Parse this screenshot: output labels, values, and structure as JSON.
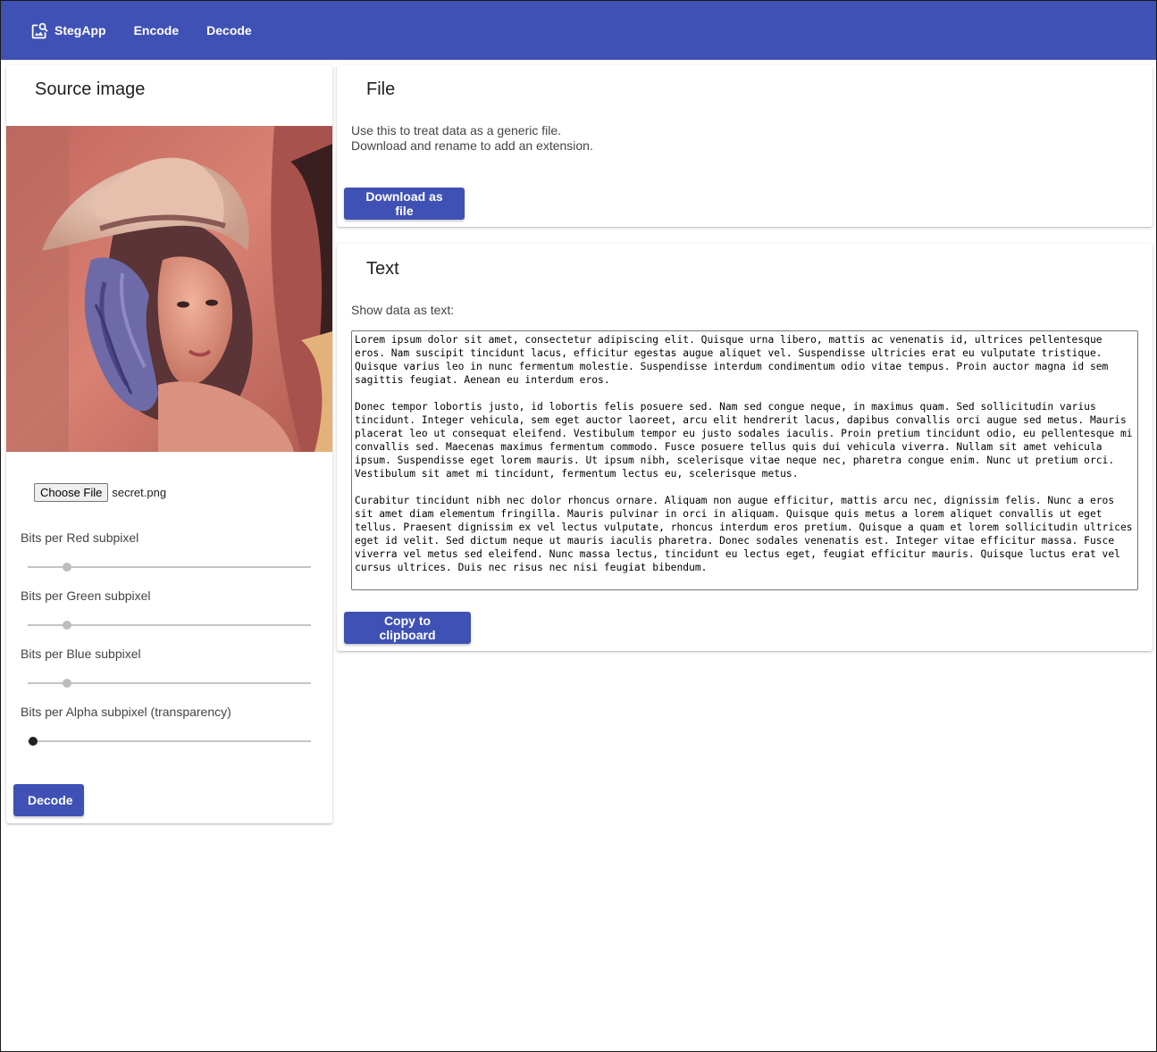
{
  "nav": {
    "brand": "StegApp",
    "links": [
      "Encode",
      "Decode"
    ]
  },
  "source": {
    "title": "Source image",
    "file_button": "Choose File",
    "file_name": "secret.png",
    "sliders": [
      {
        "label": "Bits per Red subpixel",
        "value": 1,
        "max": 8
      },
      {
        "label": "Bits per Green subpixel",
        "value": 1,
        "max": 8
      },
      {
        "label": "Bits per Blue subpixel",
        "value": 1,
        "max": 8
      },
      {
        "label": "Bits per Alpha subpixel (transparency)",
        "value": 0,
        "max": 8
      }
    ],
    "decode_button": "Decode"
  },
  "file_card": {
    "title": "File",
    "line1": "Use this to treat data as a generic file.",
    "line2": "Download and rename to add an extension.",
    "button": "Download as file"
  },
  "text_card": {
    "title": "Text",
    "label": "Show data as text:",
    "content": "Lorem ipsum dolor sit amet, consectetur adipiscing elit. Quisque urna libero, mattis ac venenatis id, ultrices pellentesque eros. Nam suscipit tincidunt lacus, efficitur egestas augue aliquet vel. Suspendisse ultricies erat eu vulputate tristique. Quisque varius leo in nunc fermentum molestie. Suspendisse interdum condimentum odio vitae tempus. Proin auctor magna id sem sagittis feugiat. Aenean eu interdum eros.\n\nDonec tempor lobortis justo, id lobortis felis posuere sed. Nam sed congue neque, in maximus quam. Sed sollicitudin varius tincidunt. Integer vehicula, sem eget auctor laoreet, arcu elit hendrerit lacus, dapibus convallis orci augue sed metus. Mauris placerat leo ut consequat eleifend. Vestibulum tempor eu justo sodales iaculis. Proin pretium tincidunt odio, eu pellentesque mi convallis sed. Maecenas maximus fermentum commodo. Fusce posuere tellus quis dui vehicula viverra. Nullam sit amet vehicula ipsum. Suspendisse eget lorem mauris. Ut ipsum nibh, scelerisque vitae neque nec, pharetra congue enim. Nunc ut pretium orci. Vestibulum sit amet mi tincidunt, fermentum lectus eu, scelerisque metus.\n\nCurabitur tincidunt nibh nec dolor rhoncus ornare. Aliquam non augue efficitur, mattis arcu nec, dignissim felis. Nunc a eros sit amet diam elementum fringilla. Mauris pulvinar in orci in aliquam. Quisque quis metus a lorem aliquet convallis ut eget tellus. Praesent dignissim ex vel lectus vulputate, rhoncus interdum eros pretium. Quisque a quam et lorem sollicitudin ultrices eget id velit. Sed dictum neque ut mauris iaculis pharetra. Donec sodales venenatis est. Integer vitae efficitur massa. Fusce viverra vel metus sed eleifend. Nunc massa lectus, tincidunt eu lectus eget, feugiat efficitur mauris. Quisque luctus erat vel cursus ultrices. Duis nec risus nec nisi feugiat bibendum.",
    "button": "Copy to clipboard"
  },
  "colors": {
    "primary": "#3f51b5",
    "slider_track": "#c4c4c4",
    "slider_thumb": "#bdbdbd",
    "slider_thumb_active": "#212121"
  },
  "icons": {
    "brand": "image-search-icon"
  }
}
